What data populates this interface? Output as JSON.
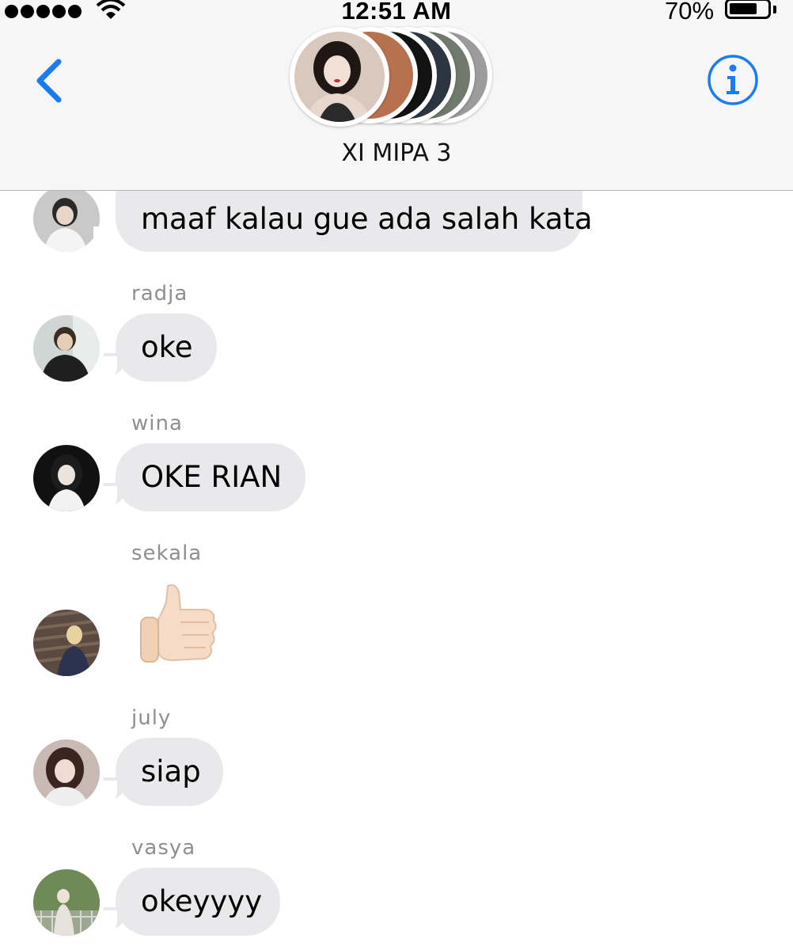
{
  "status_bar": {
    "time": "12:51 AM",
    "battery_percent": "70%",
    "battery_level": 0.7,
    "signal_bars": 5
  },
  "header": {
    "group_name": "XI MIPA 3",
    "back_icon": "chevron-left-icon",
    "info_icon": "info-icon",
    "accent_color": "#1b7cf2"
  },
  "messages": [
    {
      "sender": "",
      "text": "maaf kalau gue ada salah kata",
      "partial_text": "",
      "type": "text"
    },
    {
      "sender": "radja",
      "text": "oke",
      "type": "text"
    },
    {
      "sender": "wina",
      "text": "OKE RIAN",
      "type": "text"
    },
    {
      "sender": "sekala",
      "text": "",
      "type": "emoji",
      "emoji_icon": "thumbs-up-icon"
    },
    {
      "sender": "july",
      "text": "siap",
      "type": "text"
    },
    {
      "sender": "vasya",
      "text": "okeyyyy",
      "type": "text"
    }
  ],
  "colors": {
    "bubble": "#e9e9eb",
    "sender_label": "#8e8e93",
    "header_bg": "#f6f6f7"
  }
}
